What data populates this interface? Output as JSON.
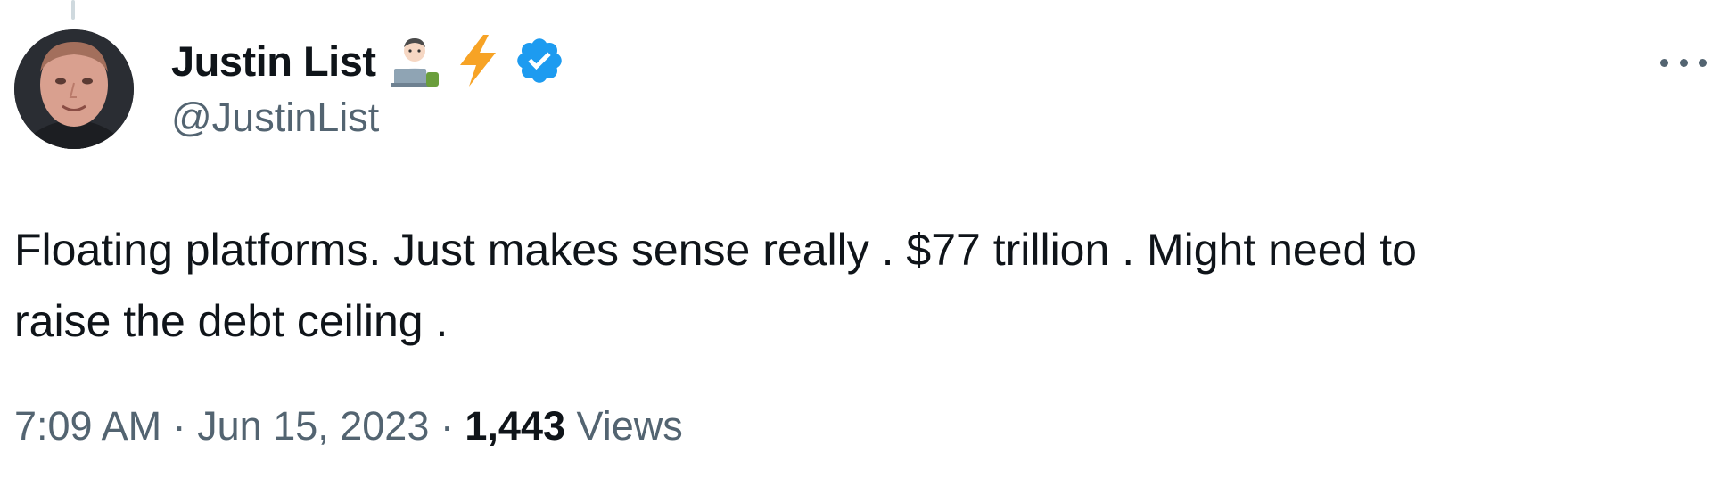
{
  "tweet": {
    "author": {
      "display_name": "Justin List",
      "handle": "@JustinList",
      "verified": true,
      "name_emojis": [
        "technologist-emoji",
        "lightning-emoji"
      ],
      "accent_color": "#1d9bf0"
    },
    "text_lines": [
      "Floating platforms. Just makes sense really . $77 trillion . Might need to",
      "raise the debt ceiling ."
    ],
    "meta": {
      "time": "7:09 AM",
      "separator": "·",
      "date": "Jun 15, 2023",
      "views_count": "1,443",
      "views_label": "Views"
    },
    "more_menu_icon": "more-horizontal-icon"
  }
}
